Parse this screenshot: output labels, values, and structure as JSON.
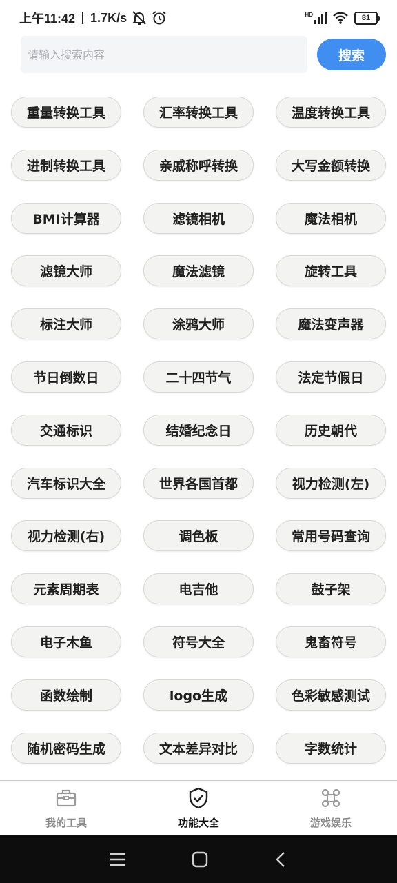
{
  "status_bar": {
    "time": "上午11:42",
    "speed": "1.7K/s",
    "signal_label": "HD",
    "battery": "81"
  },
  "search": {
    "placeholder": "请输入搜索内容",
    "value": "",
    "button_label": "搜索",
    "accent_color": "#3f8ef0"
  },
  "tools": [
    "重量转换工具",
    "汇率转换工具",
    "温度转换工具",
    "进制转换工具",
    "亲戚称呼转换",
    "大写金额转换",
    "BMI计算器",
    "滤镜相机",
    "魔法相机",
    "滤镜大师",
    "魔法滤镜",
    "旋转工具",
    "标注大师",
    "涂鸦大师",
    "魔法变声器",
    "节日倒数日",
    "二十四节气",
    "法定节假日",
    "交通标识",
    "结婚纪念日",
    "历史朝代",
    "汽车标识大全",
    "世界各国首都",
    "视力检测(左)",
    "视力检测(右)",
    "调色板",
    "常用号码查询",
    "元素周期表",
    "电吉他",
    "鼓子架",
    "电子木鱼",
    "符号大全",
    "鬼畜符号",
    "函数绘制",
    "logo生成",
    "色彩敏感测试",
    "随机密码生成",
    "文本差异对比",
    "字数统计"
  ],
  "bottom_nav": [
    {
      "label": "我的工具",
      "icon": "briefcase-icon",
      "active": false
    },
    {
      "label": "功能大全",
      "icon": "shield-check-icon",
      "active": true
    },
    {
      "label": "游戏娱乐",
      "icon": "command-icon",
      "active": false
    }
  ],
  "system_nav": [
    "menu-icon",
    "home-icon",
    "back-icon"
  ]
}
